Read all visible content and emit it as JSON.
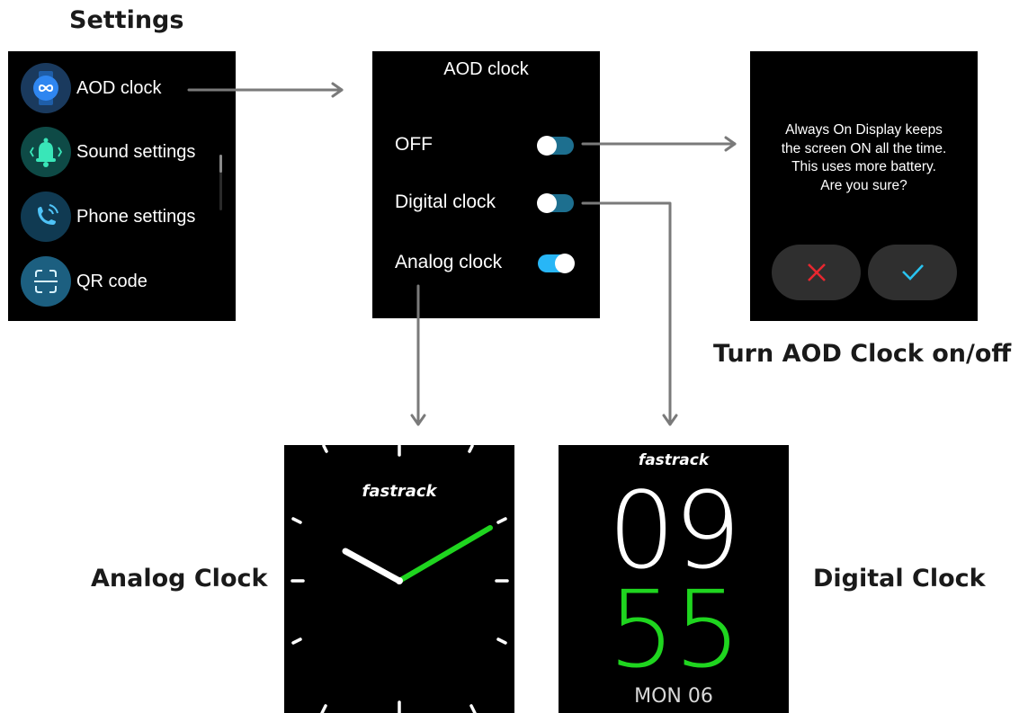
{
  "captions": {
    "settings": "Settings",
    "turn_aod": "Turn AOD Clock on/off",
    "analog": "Analog Clock",
    "digital": "Digital Clock"
  },
  "settings_screen": {
    "items": [
      {
        "label": "AOD clock",
        "icon": "infinity-watch-icon"
      },
      {
        "label": "Sound settings",
        "icon": "bell-icon"
      },
      {
        "label": "Phone settings",
        "icon": "phone-icon"
      },
      {
        "label": "QR code",
        "icon": "qr-scan-icon"
      }
    ]
  },
  "aod_screen": {
    "title": "AOD clock",
    "options": [
      {
        "label": "OFF",
        "on": false
      },
      {
        "label": "Digital clock",
        "on": false
      },
      {
        "label": "Analog clock",
        "on": true
      }
    ]
  },
  "confirm_dialog": {
    "lines": [
      "Always On Display keeps",
      "the screen ON all the time.",
      "This uses more battery.",
      "Are you sure?"
    ],
    "cancel_icon": "close-icon",
    "confirm_icon": "check-icon"
  },
  "analog_clock": {
    "brand": "fastrack"
  },
  "digital_clock": {
    "brand": "fastrack",
    "hour": "09",
    "minute": "55",
    "date": "MON 06"
  },
  "colors": {
    "accent_green": "#1fd51f",
    "toggle_blue": "#28b6f6",
    "toggle_off_track": "#1d6f8f",
    "cancel_red": "#e8272f",
    "confirm_cyan": "#29c3f0",
    "arrow_gray": "#7a7a7a"
  }
}
